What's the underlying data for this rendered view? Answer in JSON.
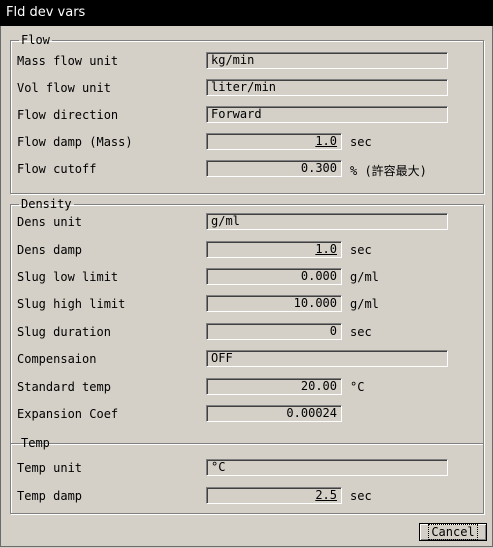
{
  "window": {
    "title": "Fld dev vars"
  },
  "flow": {
    "legend": "Flow",
    "rows": [
      {
        "label": "Mass flow unit",
        "value": "kg/min",
        "unit": ""
      },
      {
        "label": "Vol flow unit",
        "value": "liter/min",
        "unit": ""
      },
      {
        "label": "Flow direction",
        "value": "Forward",
        "unit": ""
      },
      {
        "label": "Flow damp (Mass)",
        "value": "1.0",
        "unit": "sec"
      },
      {
        "label": "Flow cutoff",
        "value": "0.300",
        "unit": "% (許容最大)"
      }
    ]
  },
  "density": {
    "legend": "Density",
    "rows": [
      {
        "label": "Dens unit",
        "value": "g/ml",
        "unit": ""
      },
      {
        "label": "Dens damp",
        "value": "1.0",
        "unit": "sec"
      },
      {
        "label": "Slug low limit",
        "value": "0.000",
        "unit": "g/ml"
      },
      {
        "label": "Slug high limit",
        "value": "10.000",
        "unit": "g/ml"
      },
      {
        "label": "Slug duration",
        "value": "0",
        "unit": "sec"
      },
      {
        "label": "Compensaion",
        "value": "OFF",
        "unit": ""
      },
      {
        "label": "Standard temp",
        "value": "20.00",
        "unit": "°C"
      },
      {
        "label": "Expansion Coef",
        "value": "0.00024",
        "unit": ""
      }
    ]
  },
  "temp": {
    "legend": "Temp",
    "rows": [
      {
        "label": "Temp unit",
        "value": "°C",
        "unit": ""
      },
      {
        "label": "Temp damp",
        "value": "2.5",
        "unit": "sec"
      }
    ]
  },
  "buttons": {
    "cancel": "Cancel"
  }
}
